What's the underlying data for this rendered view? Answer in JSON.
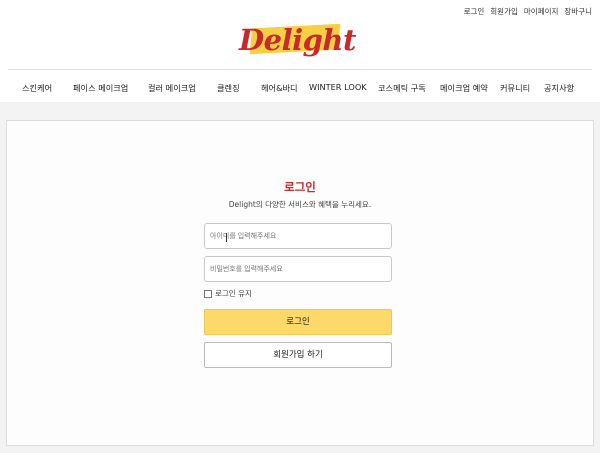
{
  "header": {
    "util_links": [
      "로그인",
      "회원가입",
      "마이페이지",
      "장바구니"
    ],
    "logo_text": "Delight",
    "nav": [
      "스킨케어",
      "페이스 메이크업",
      "컬러 메이크업",
      "클렌징",
      "헤어&바디",
      "WINTER LOOK",
      "코스메틱 구독",
      "메이크업 예약",
      "커뮤니티",
      "공지사항"
    ]
  },
  "login": {
    "title": "로그인",
    "subtitle": "Delight의 다양한 서비스와 혜택을 누리세요.",
    "id_placeholder": "아이디를 입력해주세요",
    "pw_placeholder": "비밀번호를 입력해주세요",
    "remember_label": "로그인 유지",
    "login_button": "로그인",
    "join_button": "회원가입 하기"
  },
  "colors": {
    "brand_red": "#c62a2a",
    "brand_yellow": "#f7cf45",
    "button_yellow": "#fcd968"
  }
}
